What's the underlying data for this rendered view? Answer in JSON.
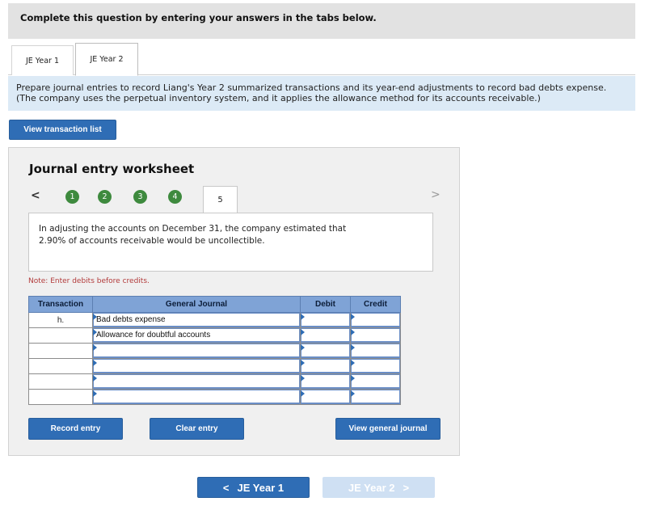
{
  "header": {
    "title": "Complete this question by entering your answers in the tabs below."
  },
  "tabs": [
    {
      "label": "JE Year 1",
      "active": false
    },
    {
      "label": "JE Year 2",
      "active": true
    }
  ],
  "instructions": {
    "line1": "Prepare journal entries to record Liang's Year 2 summarized transactions and its year-end adjustments to record bad debts expense.",
    "line2": "(The company uses the perpetual inventory system, and it applies the allowance method for its accounts receivable.)"
  },
  "view_transaction_list_label": "View transaction list",
  "worksheet": {
    "title": "Journal entry worksheet",
    "nav_prev": "<",
    "nav_next": ">",
    "steps": [
      "1",
      "2",
      "3",
      "4"
    ],
    "active_step": "5",
    "description_line1": "In adjusting the accounts on December 31, the company estimated that",
    "description_line2": "2.90% of accounts receivable would be uncollectible.",
    "note": "Note: Enter debits before credits.",
    "table": {
      "headers": {
        "transaction": "Transaction",
        "general_journal": "General Journal",
        "debit": "Debit",
        "credit": "Credit"
      },
      "rows": [
        {
          "transaction": "h.",
          "account": "Bad debts expense",
          "debit": "",
          "credit": ""
        },
        {
          "transaction": "",
          "account": "Allowance for doubtful accounts",
          "debit": "",
          "credit": ""
        },
        {
          "transaction": "",
          "account": "",
          "debit": "",
          "credit": ""
        },
        {
          "transaction": "",
          "account": "",
          "debit": "",
          "credit": ""
        },
        {
          "transaction": "",
          "account": "",
          "debit": "",
          "credit": ""
        },
        {
          "transaction": "",
          "account": "",
          "debit": "",
          "credit": ""
        }
      ]
    },
    "record_entry_label": "Record entry",
    "clear_entry_label": "Clear entry",
    "view_general_journal_label": "View general journal"
  },
  "bottom_nav": {
    "prev_label": "JE Year 1",
    "prev_arrow": "<",
    "next_label": "JE Year 2",
    "next_arrow": ">"
  },
  "colors": {
    "primary_button": "#2f6db5",
    "step_complete": "#3e8a3e",
    "table_header": "#7fa3d6",
    "instructions_bg": "#dceaf6"
  }
}
